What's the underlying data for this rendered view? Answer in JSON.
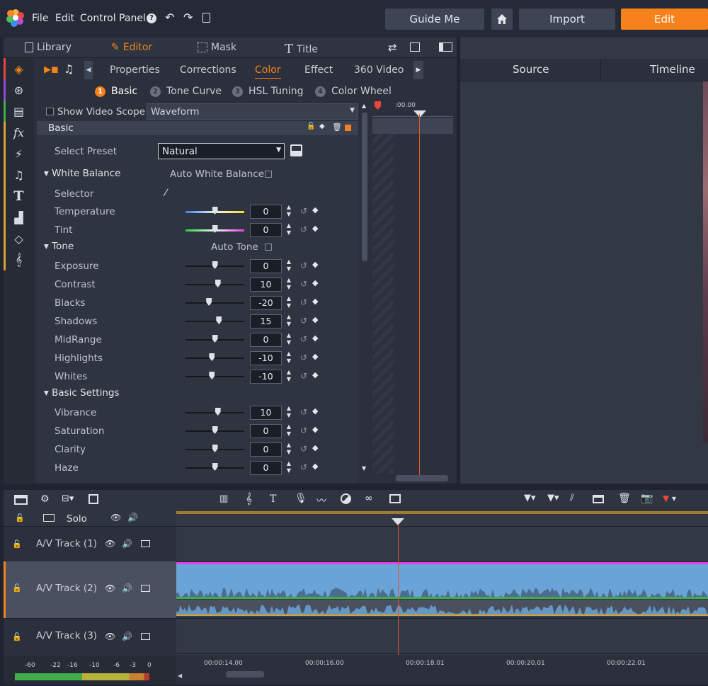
{
  "menu": {
    "file": "File",
    "edit": "Edit",
    "control_panel": "Control Panel"
  },
  "top_buttons": {
    "guide": "Guide Me",
    "import": "Import",
    "edit": "Edit"
  },
  "tabs1": [
    "Library",
    "Editor",
    "Mask",
    "Title"
  ],
  "tabs2": [
    "Properties",
    "Corrections",
    "Color",
    "Effect",
    "360 Video"
  ],
  "subtabs": [
    {
      "num": "1",
      "label": "Basic"
    },
    {
      "num": "2",
      "label": "Tone Curve"
    },
    {
      "num": "3",
      "label": "HSL Tuning"
    },
    {
      "num": "4",
      "label": "Color Wheel"
    }
  ],
  "scope": {
    "label": "Show Video Scope",
    "value": "Waveform"
  },
  "panel_title": "Basic",
  "preset": {
    "label": "Select Preset",
    "value": "Natural"
  },
  "white_balance": {
    "label": "White Balance",
    "auto": "Auto White Balance",
    "selector": "Selector"
  },
  "tone": {
    "label": "Tone",
    "auto": "Auto Tone"
  },
  "basic_settings": "Basic Settings",
  "params": {
    "temperature": {
      "label": "Temperature",
      "value": "0",
      "pos": 0.5
    },
    "tint": {
      "label": "Tint",
      "value": "0",
      "pos": 0.5
    },
    "exposure": {
      "label": "Exposure",
      "value": "0",
      "pos": 0.5
    },
    "contrast": {
      "label": "Contrast",
      "value": "10",
      "pos": 0.55
    },
    "blacks": {
      "label": "Blacks",
      "value": "-20",
      "pos": 0.4
    },
    "shadows": {
      "label": "Shadows",
      "value": "15",
      "pos": 0.57
    },
    "midrange": {
      "label": "MidRange",
      "value": "0",
      "pos": 0.5
    },
    "highlights": {
      "label": "Highlights",
      "value": "-10",
      "pos": 0.45
    },
    "whites": {
      "label": "Whites",
      "value": "-10",
      "pos": 0.45
    },
    "vibrance": {
      "label": "Vibrance",
      "value": "10",
      "pos": 0.55
    },
    "saturation": {
      "label": "Saturation",
      "value": "0",
      "pos": 0.5
    },
    "clarity": {
      "label": "Clarity",
      "value": "0",
      "pos": 0.5
    },
    "haze": {
      "label": "Haze",
      "value": "0",
      "pos": 0.5
    }
  },
  "mini_timecode": ":00.00",
  "right_tabs": {
    "source": "Source",
    "timeline": "Timeline"
  },
  "tracks": {
    "solo": "Solo",
    "t1": "A/V Track (1)",
    "t2": "A/V Track (2)",
    "t3": "A/V Track (3)"
  },
  "ruler": [
    "00:00:14.00",
    "00:00:16.00",
    "00:00:18.01",
    "00:00:20.01",
    "00:00:22.01"
  ],
  "meter": [
    "-60",
    "-22",
    "-16",
    "-10",
    "-6",
    "-3",
    "0"
  ],
  "colors": {
    "accent": "#f7821b",
    "clip": "#6aa3d8",
    "playhead": "#e0582a"
  }
}
